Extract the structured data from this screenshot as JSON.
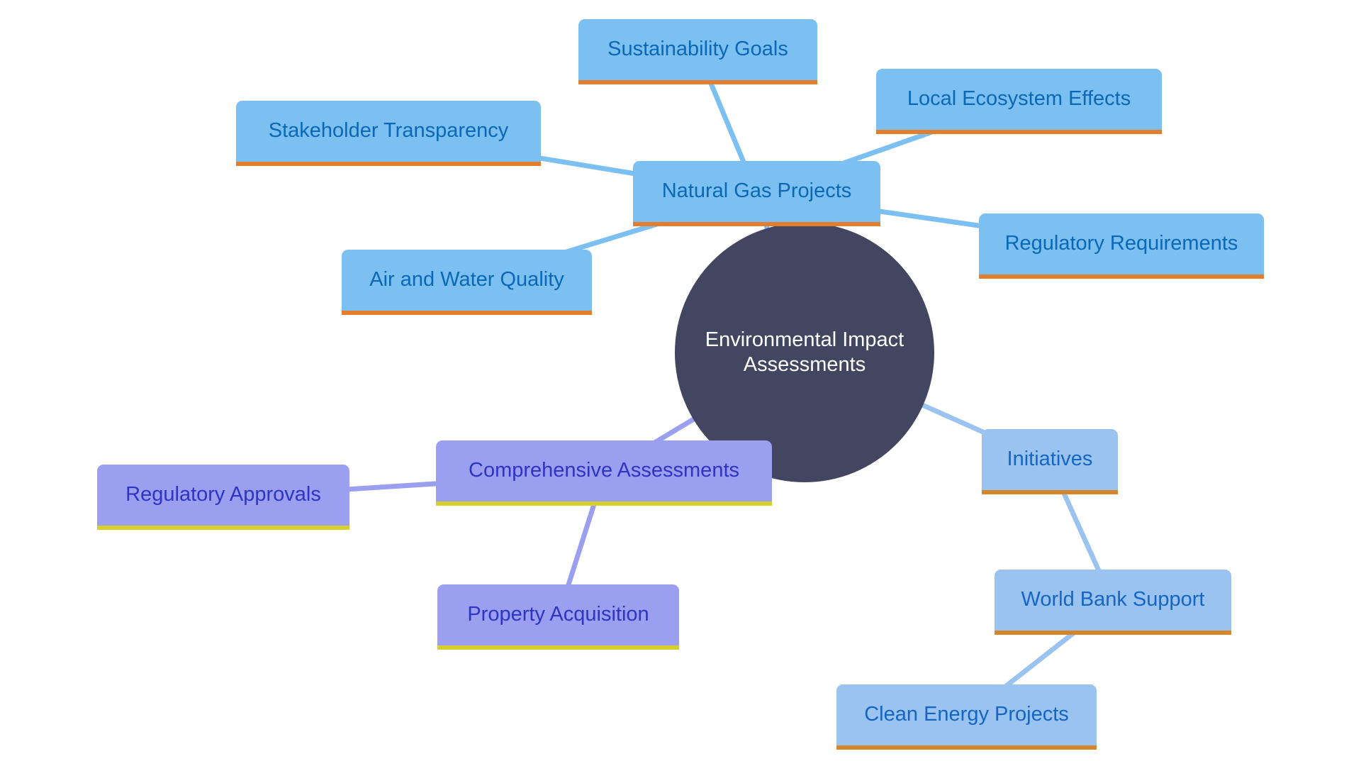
{
  "diagram": {
    "type": "mindmap",
    "root": {
      "id": "eia",
      "label_line1": "Environmental Impact",
      "label_line2": "Assessments",
      "color": "#424660",
      "text_color": "#ffffff"
    },
    "styles": {
      "blue": {
        "fill": "#7bc0f1",
        "border": "#e37e2f",
        "text": "#0b68b5",
        "edge": "#7bc0f1"
      },
      "indigo": {
        "fill": "#9b9ff0",
        "border": "#d6cf2c",
        "text": "#2f34c2",
        "edge": "#9b9ff0"
      },
      "lightblue": {
        "fill": "#9ac3ef",
        "border": "#d8842a",
        "text": "#1566c4",
        "edge": "#9ac3ef"
      }
    },
    "nodes": [
      {
        "id": "ngp",
        "label": "Natural Gas Projects",
        "style": "blue",
        "parent": "eia"
      },
      {
        "id": "sg",
        "label": "Sustainability Goals",
        "style": "blue",
        "parent": "ngp"
      },
      {
        "id": "lee",
        "label": "Local Ecosystem Effects",
        "style": "blue",
        "parent": "ngp"
      },
      {
        "id": "st",
        "label": "Stakeholder Transparency",
        "style": "blue",
        "parent": "ngp"
      },
      {
        "id": "rr",
        "label": "Regulatory Requirements",
        "style": "blue",
        "parent": "ngp"
      },
      {
        "id": "awq",
        "label": "Air and Water Quality",
        "style": "blue",
        "parent": "ngp"
      },
      {
        "id": "ca",
        "label": "Comprehensive Assessments",
        "style": "indigo",
        "parent": "eia"
      },
      {
        "id": "ra",
        "label": "Regulatory Approvals",
        "style": "indigo",
        "parent": "ca"
      },
      {
        "id": "pa",
        "label": "Property Acquisition",
        "style": "indigo",
        "parent": "ca"
      },
      {
        "id": "ini",
        "label": "Initiatives",
        "style": "lightblue",
        "parent": "eia"
      },
      {
        "id": "wbs",
        "label": "World Bank Support",
        "style": "lightblue",
        "parent": "ini"
      },
      {
        "id": "cep",
        "label": "Clean Energy Projects",
        "style": "lightblue",
        "parent": "wbs"
      }
    ]
  }
}
